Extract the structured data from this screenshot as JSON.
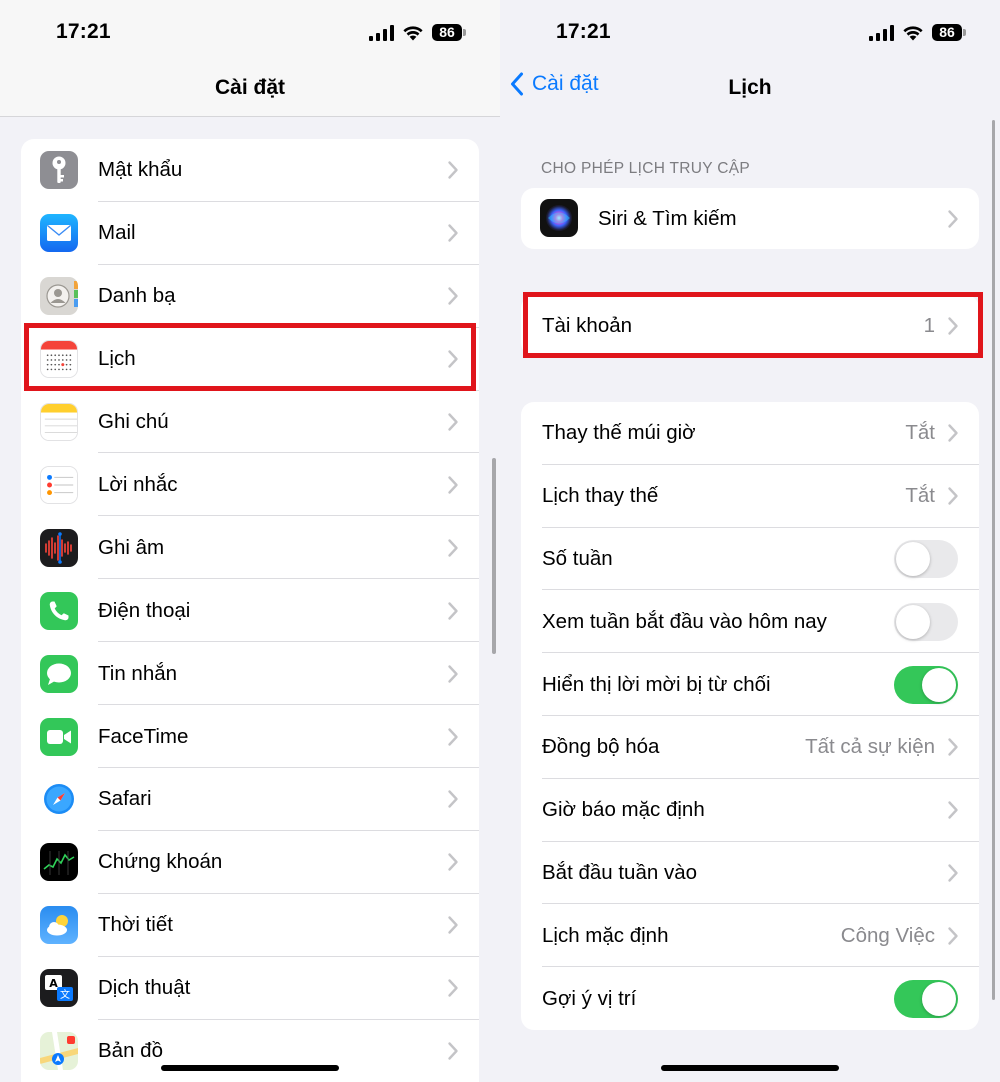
{
  "status_bar": {
    "time": "17:21",
    "battery": "86"
  },
  "left": {
    "title": "Cài đặt",
    "items": [
      {
        "label": "Mật khẩu",
        "icon": "key-icon"
      },
      {
        "label": "Mail",
        "icon": "mail-icon"
      },
      {
        "label": "Danh bạ",
        "icon": "contacts-icon"
      },
      {
        "label": "Lịch",
        "icon": "calendar-icon"
      },
      {
        "label": "Ghi chú",
        "icon": "notes-icon"
      },
      {
        "label": "Lời nhắc",
        "icon": "reminders-icon"
      },
      {
        "label": "Ghi âm",
        "icon": "voice-memos-icon"
      },
      {
        "label": "Điện thoại",
        "icon": "phone-icon"
      },
      {
        "label": "Tin nhắn",
        "icon": "messages-icon"
      },
      {
        "label": "FaceTime",
        "icon": "facetime-icon"
      },
      {
        "label": "Safari",
        "icon": "safari-icon"
      },
      {
        "label": "Chứng khoán",
        "icon": "stocks-icon"
      },
      {
        "label": "Thời tiết",
        "icon": "weather-icon"
      },
      {
        "label": "Dịch thuật",
        "icon": "translate-icon"
      },
      {
        "label": "Bản đồ",
        "icon": "maps-icon"
      }
    ]
  },
  "right": {
    "back_label": "Cài đặt",
    "title": "Lịch",
    "access_header": "CHO PHÉP LỊCH TRUY CẬP",
    "siri": {
      "label": "Siri & Tìm kiếm",
      "icon": "siri-icon"
    },
    "accounts": {
      "label": "Tài khoản",
      "value": "1"
    },
    "options": [
      {
        "label": "Thay thế múi giờ",
        "value": "Tắt",
        "kind": "value"
      },
      {
        "label": "Lịch thay thế",
        "value": "Tắt",
        "kind": "value"
      },
      {
        "label": "Số tuần",
        "state": "off",
        "kind": "toggle"
      },
      {
        "label": "Xem tuần bắt đầu vào hôm nay",
        "state": "off",
        "kind": "toggle"
      },
      {
        "label": "Hiển thị lời mời bị từ chối",
        "state": "on",
        "kind": "toggle"
      },
      {
        "label": "Đồng bộ hóa",
        "value": "Tất cả sự kiện",
        "kind": "value"
      },
      {
        "label": "Giờ báo mặc định",
        "value": "",
        "kind": "value"
      },
      {
        "label": "Bắt đầu tuần vào",
        "value": "",
        "kind": "value"
      },
      {
        "label": "Lịch mặc định",
        "value": "Công Việc",
        "kind": "value"
      },
      {
        "label": "Gợi ý vị trí",
        "state": "on",
        "kind": "toggle"
      }
    ]
  },
  "colors": {
    "accent": "#0a7aff",
    "toggle_on": "#34c759",
    "highlight": "#e0151b"
  }
}
